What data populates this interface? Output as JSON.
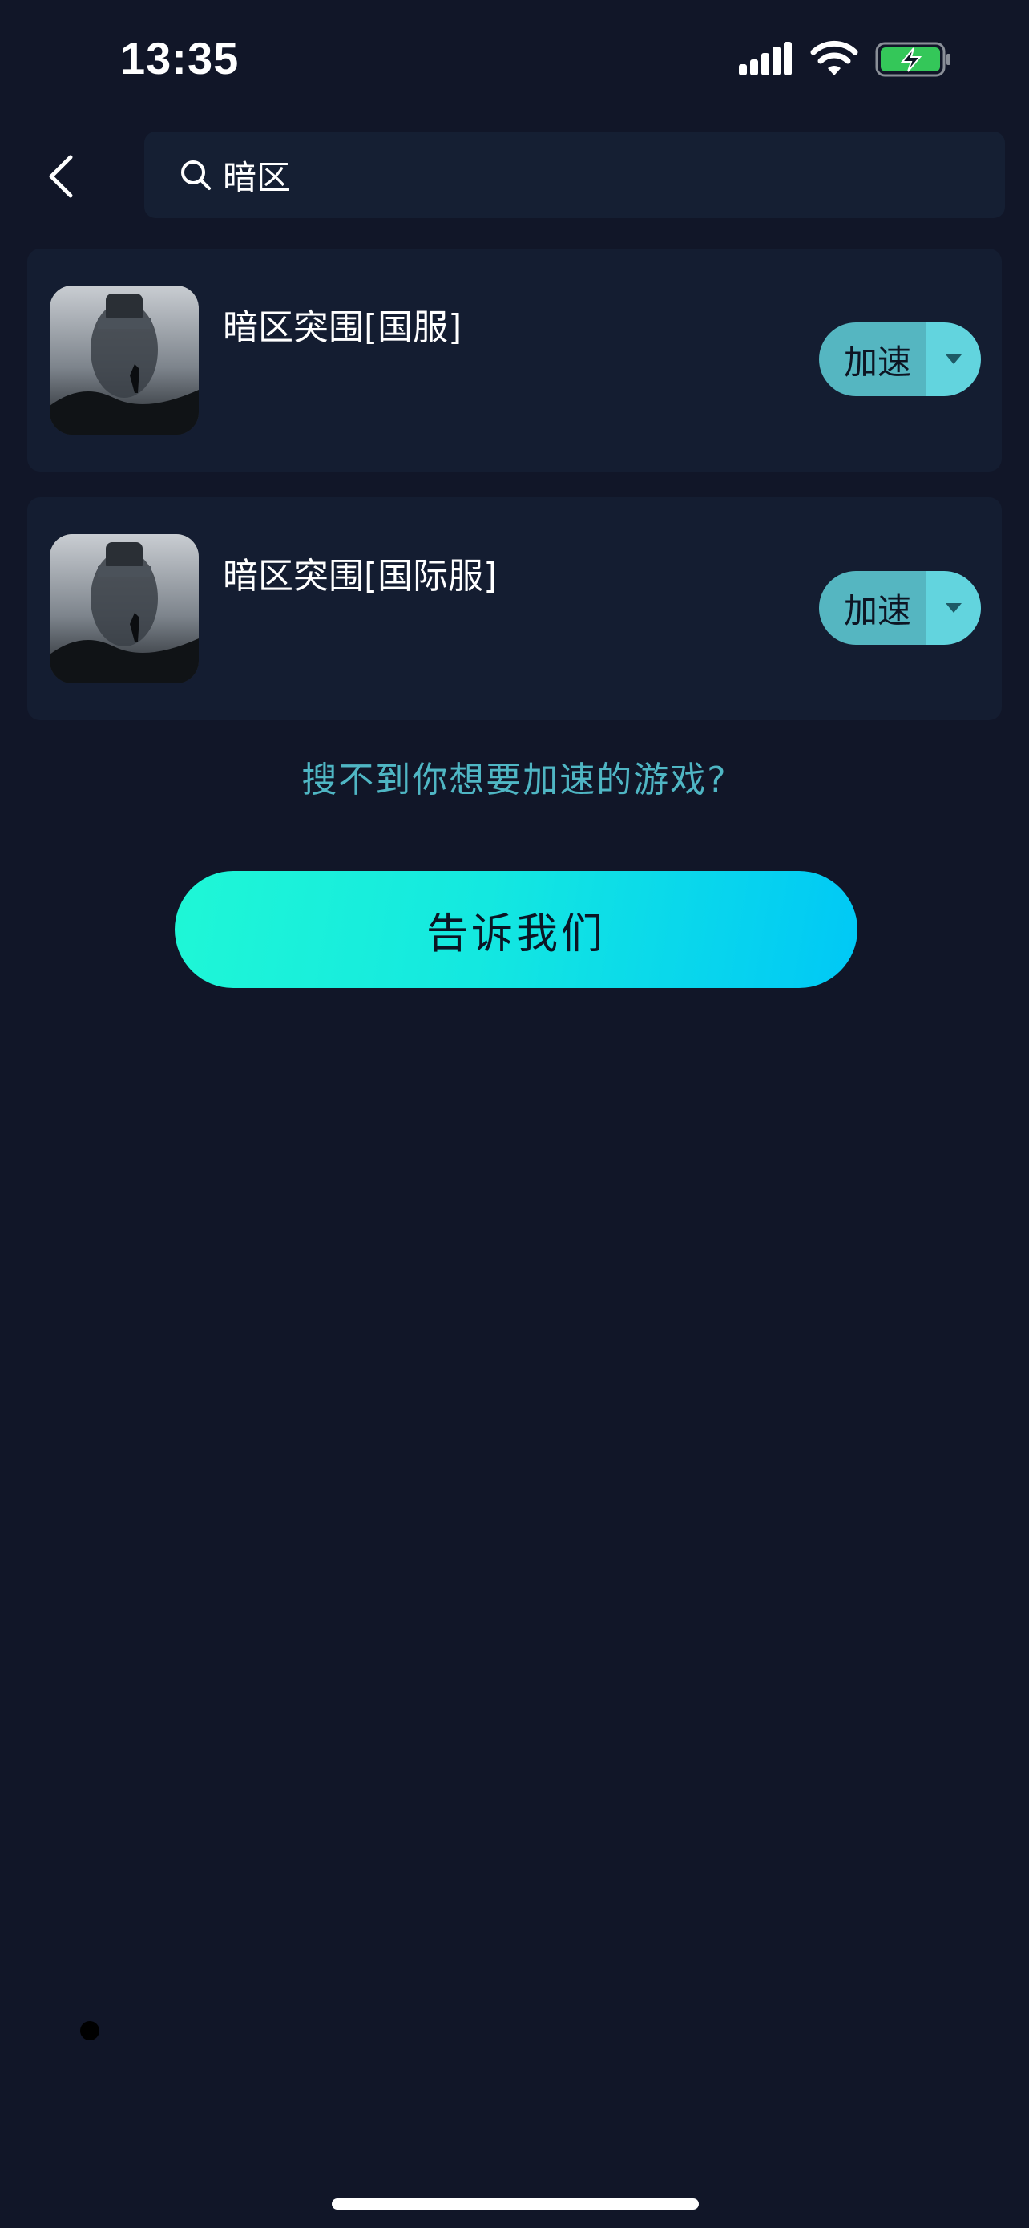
{
  "status_bar": {
    "time": "13:35",
    "icons": [
      "signal-icon",
      "wifi-icon",
      "battery-charging-icon"
    ]
  },
  "header": {
    "back_icon": "chevron-left-icon",
    "search": {
      "icon": "search-icon",
      "value": "暗区",
      "placeholder": ""
    }
  },
  "results": [
    {
      "title": "暗区突围[国服]",
      "action_label": "加速",
      "dropdown_icon": "caret-down-icon"
    },
    {
      "title": "暗区突围[国际服]",
      "action_label": "加速",
      "dropdown_icon": "caret-down-icon"
    }
  ],
  "help": {
    "text": "搜不到你想要加速的游戏?",
    "button_label": "告诉我们"
  },
  "colors": {
    "background": "#111628",
    "card": "#141d31",
    "accent_text": "#4fb6c4",
    "button_gradient_start": "#1ff7d6",
    "button_gradient_end": "#00c8f6",
    "accelerate_label_bg": "#55b6c1",
    "accelerate_drop_bg": "#62d4de",
    "battery_green": "#34c759"
  }
}
